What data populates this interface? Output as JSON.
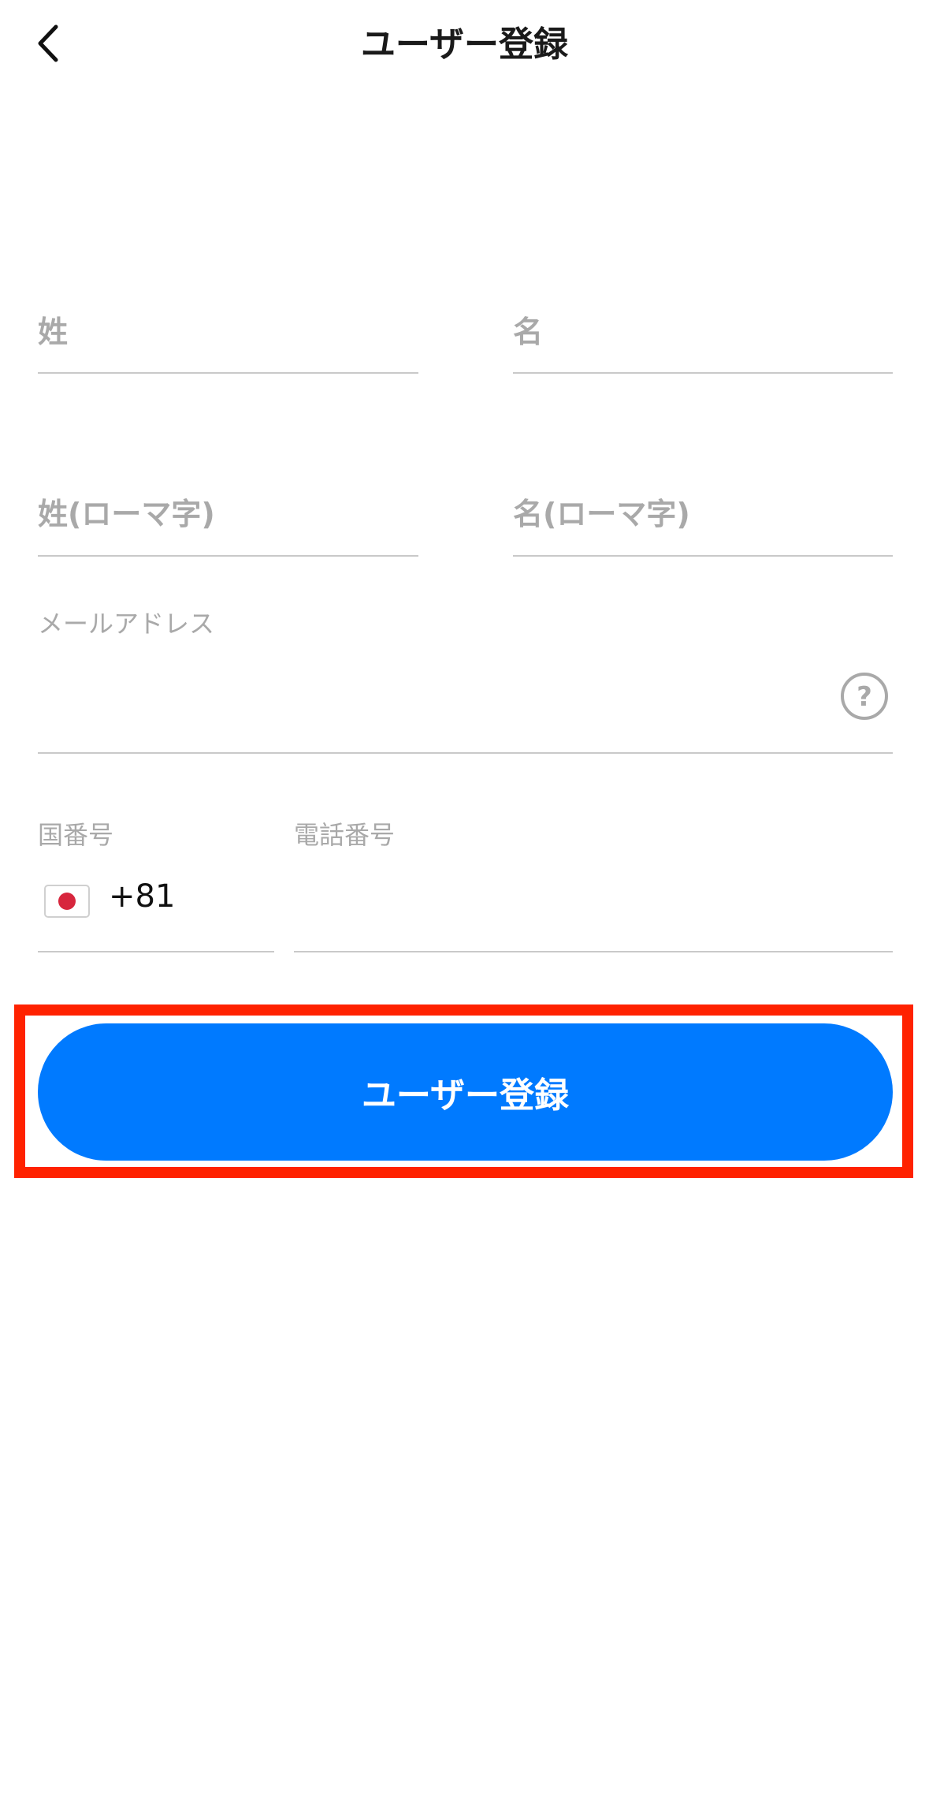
{
  "header": {
    "title": "ユーザー登録"
  },
  "form": {
    "last_name_placeholder": "姓",
    "first_name_placeholder": "名",
    "last_name_roman_placeholder": "姓(ローマ字)",
    "first_name_roman_placeholder": "名(ローマ字)",
    "email_label": "メールアドレス",
    "country_code_label": "国番号",
    "phone_label": "電話番号",
    "country_code_value": "+81",
    "flag_icon": "japan-flag-icon",
    "help_icon": "question-mark-icon"
  },
  "actions": {
    "submit_label": "ユーザー登録"
  },
  "colors": {
    "primary": "#007aff",
    "highlight": "#ff2200",
    "placeholder": "#a9a9a9",
    "divider": "#c9c9c9"
  }
}
